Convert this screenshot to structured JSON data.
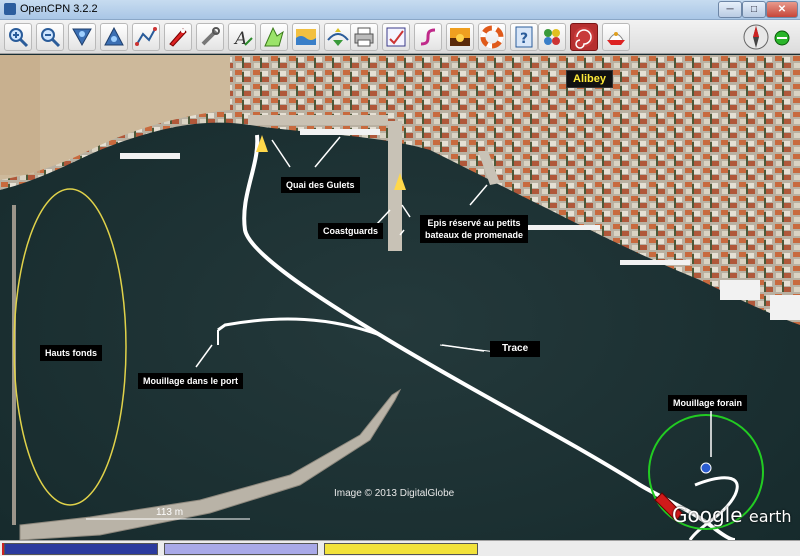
{
  "window": {
    "title": "OpenCPN 3.2.2",
    "min_label": "─",
    "max_label": "□",
    "close_label": "✕"
  },
  "toolbar": {
    "buttons": [
      {
        "name": "zoom-in-icon"
      },
      {
        "name": "zoom-out-icon"
      },
      {
        "name": "scale-in-icon"
      },
      {
        "name": "scale-out-icon"
      },
      {
        "name": "create-route-icon"
      },
      {
        "name": "auto-follow-icon"
      },
      {
        "name": "settings-icon"
      },
      {
        "name": "text-icon"
      },
      {
        "name": "current-icon"
      },
      {
        "name": "tide-icon"
      },
      {
        "name": "ais-icon"
      },
      {
        "name": "print-icon"
      },
      {
        "name": "route-manager-icon"
      },
      {
        "name": "track-icon"
      },
      {
        "name": "color-scheme-icon"
      },
      {
        "name": "man-overboard-icon"
      },
      {
        "name": "help-icon"
      },
      {
        "name": "plugin-icon"
      },
      {
        "name": "radar-icon"
      },
      {
        "name": "plugin-chart-icon"
      }
    ],
    "compass_label": "N"
  },
  "map": {
    "place_label": "Alibey",
    "annotations": {
      "quai": "Quai des Gulets",
      "coastguards": "Coastguards",
      "epis_line1": "Epis réservé au petits",
      "epis_line2": "bateaux de promenade",
      "hauts_fonds": "Hauts fonds",
      "mouillage_port": "Mouillage dans le port",
      "trace": "Trace",
      "mouillage_forain": "Mouillage forain"
    },
    "attribution": "Image © 2013 DigitalGlobe",
    "scale_label": "113 m",
    "logo_google": "Google",
    "logo_earth": "earth",
    "colors": {
      "sea": "#1c3336",
      "land": "#c9c3b4",
      "track": "#ffffff",
      "shoal_ellipse": "#e0d24a",
      "anchor_circle": "#22cc22"
    }
  },
  "statusbar": {
    "segments": [
      {
        "color": "#2b3a9e"
      },
      {
        "color": "#a9a9e8"
      },
      {
        "color": "#f2e23a"
      }
    ]
  }
}
